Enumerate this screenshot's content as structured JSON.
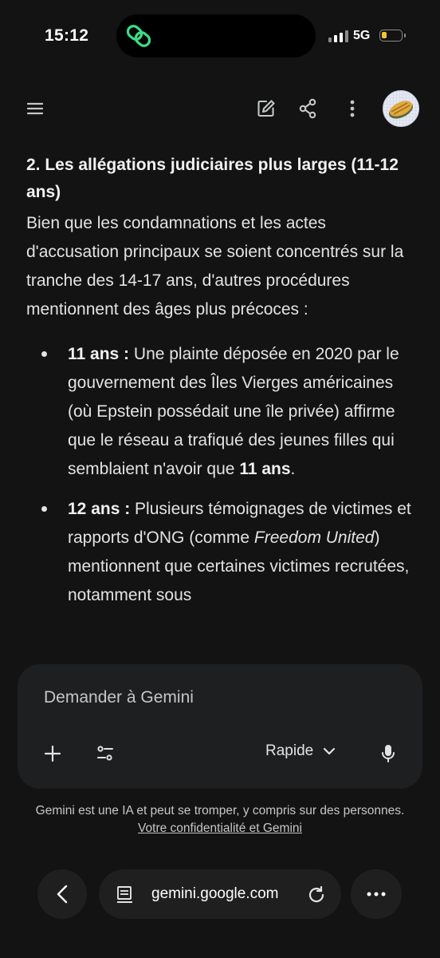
{
  "status_bar": {
    "time": "15:12",
    "network": "5G",
    "battery_level": 0.2
  },
  "colors": {
    "background": "#131314",
    "link_icon": "#3ddc84",
    "battery": "#f4c430",
    "composer": "#1e1f20"
  },
  "content": {
    "heading": "2. Les allégations judiciaires plus larges (11-12 ans)",
    "intro": "Bien que les condamnations et les actes d'accusation principaux se soient concentrés sur la tranche des 14-17 ans, d'autres procédures mentionnent des âges plus précoces :",
    "bullets": [
      {
        "lead": "11 ans :",
        "text": " Une plainte déposée en 2020 par le gouvernement des Îles Vierges américaines (où Epstein possédait une île privée) affirme que le réseau a trafiqué des jeunes filles qui semblaient n'avoir que ",
        "emph": "11 ans",
        "tail": "."
      },
      {
        "lead": "12 ans :",
        "text": " Plusieurs témoignages de victimes et rapports d'ONG (comme ",
        "italic": "Freedom United",
        "tail": ") mentionnent que certaines victimes recrutées, notamment sous"
      }
    ]
  },
  "composer": {
    "placeholder": "Demander à Gemini",
    "model_label": "Rapide"
  },
  "disclaimer": {
    "text": "Gemini est une IA et peut se tromper, y compris sur des personnes. ",
    "link": "Votre confidentialité et Gemini"
  },
  "browser": {
    "url": "gemini.google.com"
  },
  "icons": [
    "link-icon",
    "menu-icon",
    "edit-icon",
    "share-icon",
    "more-vert-icon",
    "avatar",
    "plus-icon",
    "tune-icon",
    "chevron-down-icon",
    "mic-icon",
    "back-icon",
    "page-icon",
    "reload-icon",
    "more-horiz-icon"
  ]
}
